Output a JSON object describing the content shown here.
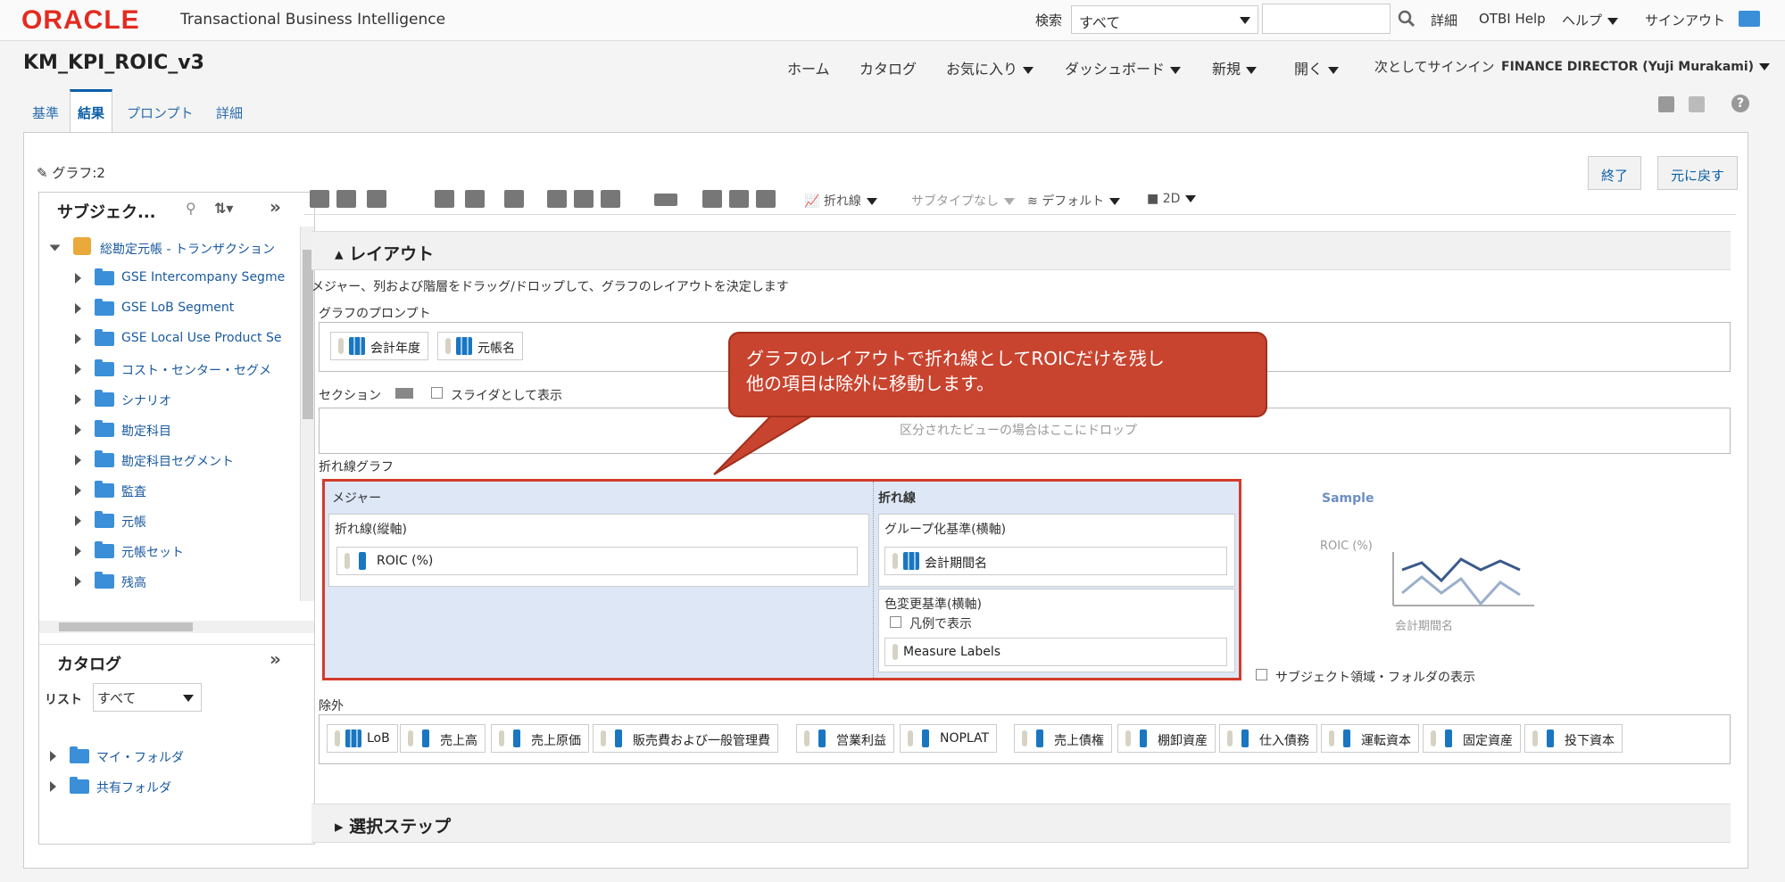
{
  "topbar": {
    "brand": "ORACLE",
    "product": "Transactional Business Intelligence",
    "search_label": "検索",
    "search_scope": "すべて",
    "search_value": "",
    "links": [
      "詳細",
      "OTBI Help",
      "ヘルプ",
      "サインアウト"
    ]
  },
  "header": {
    "title": "KM_KPI_ROIC_v3",
    "nav": [
      "ホーム",
      "カタログ",
      "お気に入り",
      "ダッシュボード",
      "新規",
      "開く"
    ],
    "signin_label": "次としてサインイン",
    "user": "FINANCE DIRECTOR (Yuji Murakami)"
  },
  "tabs": [
    "基準",
    "結果",
    "プロンプト",
    "詳細"
  ],
  "active_tab": "結果",
  "editor": {
    "edit_label": "グラフ:2",
    "done_button": "終了",
    "undo_button": "元に戻す"
  },
  "subject_panel": {
    "title": "サブジェク...",
    "root": "総勘定元帳 - トランザクション",
    "folders": [
      "GSE Intercompany Segme",
      "GSE LoB Segment",
      "GSE Local Use Product Se",
      "コスト・センター・セグメ",
      "シナリオ",
      "勘定科目",
      "勘定科目セグメント",
      "監査",
      "元帳",
      "元帳セット",
      "残高"
    ]
  },
  "catalog_panel": {
    "title": "カタログ",
    "list_label": "リスト",
    "list_value": "すべて",
    "folders": [
      "マイ・フォルダ",
      "共有フォルダ"
    ]
  },
  "toolbar": {
    "chart_type": "折れ線",
    "subtype": "サブタイプなし",
    "style": "デフォルト",
    "dimension": "2D"
  },
  "layout": {
    "section_title": "レイアウト",
    "instruction": "メジャー、列および階層をドラッグ/ドロップして、グラフのレイアウトを決定します",
    "graph_prompts_label": "グラフのプロンプト",
    "graph_prompts": [
      "会計年度",
      "元帳名"
    ],
    "sections_label": "セクション",
    "slider_label": "スライダとして表示",
    "section_drop_hint": "区分されたビューの場合はここにドロップ",
    "line_graph_label": "折れ線グラフ",
    "measures_label": "メジャー",
    "line_vertical_label": "折れ線(縦軸)",
    "measure_item": "ROIC (%)",
    "line_label": "折れ線",
    "group_by_label": "グループ化基準(横軸)",
    "group_by_item": "会計期間名",
    "vary_color_label": "色変更基準(横軸)",
    "show_in_legend_label": "凡例で表示",
    "vary_color_item": "Measure Labels",
    "sample_title": "Sample",
    "sample_y_label": "ROIC (%)",
    "sample_x_label": "会計期間名",
    "show_subject_label": "サブジェクト領域・フォルダの表示",
    "excluded_label": "除外",
    "excluded_items": [
      "LoB",
      "売上高",
      "売上原価",
      "販売費および一般管理費",
      "営業利益",
      "NOPLAT",
      "売上債権",
      "棚卸資産",
      "仕入債務",
      "運転資本",
      "固定資産",
      "投下資本"
    ]
  },
  "selection_steps": "選択ステップ",
  "callout": {
    "line1": "グラフのレイアウトで折れ線としてROICだけを残し",
    "line2": "他の項目は除外に移動します。"
  },
  "colors": {
    "accent": "#0a5fa8",
    "oracle_red": "#e32b20",
    "highlight_border": "#d33b2b",
    "callout_fill": "#c8442f"
  }
}
